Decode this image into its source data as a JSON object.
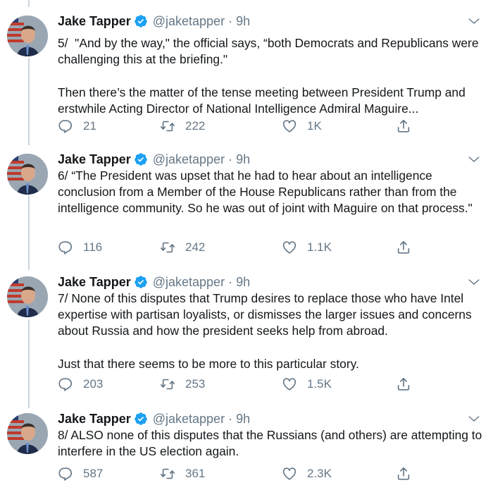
{
  "tweets": [
    {
      "name": "Jake Tapper",
      "handle": "@jaketapper",
      "separator": "·",
      "time": "9h",
      "text": "5/  \"And by the way,\" the official says, “both Democrats and Republicans were challenging this at the briefing.\"\n\nThen there’s the matter of the tense meeting between President Trump and erstwhile Acting Director of National Intelligence Admiral Maguire...",
      "replies": "21",
      "retweets": "222",
      "likes": "1K"
    },
    {
      "name": "Jake Tapper",
      "handle": "@jaketapper",
      "separator": "·",
      "time": "9h",
      "text": "6/ “The President was upset that he had to hear about an intelligence conclusion from a Member of the House Republicans rather than from the intelligence community. So he was out of joint with Maguire on that process.\"",
      "replies": "116",
      "retweets": "242",
      "likes": "1.1K"
    },
    {
      "name": "Jake Tapper",
      "handle": "@jaketapper",
      "separator": "·",
      "time": "9h",
      "text": "7/ None of this disputes that Trump desires to replace those who have Intel expertise with partisan loyalists, or dismisses the larger issues and concerns about Russia and how the president seeks help from abroad.\n\nJust that there seems to be more to this particular story.",
      "replies": "203",
      "retweets": "253",
      "likes": "1.5K"
    },
    {
      "name": "Jake Tapper",
      "handle": "@jaketapper",
      "separator": "·",
      "time": "9h",
      "text": "8/ ALSO none of this disputes that the Russians (and others) are attempting to interfere in the US election again.",
      "replies": "587",
      "retweets": "361",
      "likes": "2.3K"
    }
  ],
  "colors": {
    "verified": "#1da1f2",
    "secondary_text": "#657786",
    "thread_line": "#ccd6dd"
  },
  "icons": [
    "verified-badge-icon",
    "chevron-down-icon",
    "reply-icon",
    "retweet-icon",
    "like-icon",
    "share-icon"
  ]
}
